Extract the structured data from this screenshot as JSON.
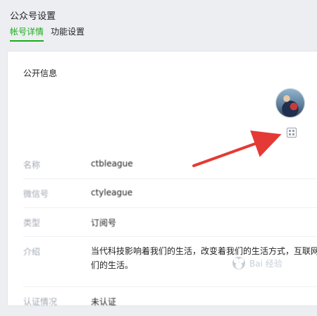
{
  "page": {
    "title": "公众号设置"
  },
  "tabs": [
    {
      "label": "帐号详情",
      "active": true
    },
    {
      "label": "功能设置",
      "active": false
    }
  ],
  "section": {
    "title": "公开信息"
  },
  "fields": [
    {
      "label": "名称",
      "value": "ctbleague"
    },
    {
      "label": "微信号",
      "value": "ctyleague"
    },
    {
      "label": "类型",
      "value": "订阅号"
    },
    {
      "label": "介绍",
      "value": "当代科技影响着我们的生活，改变着我们的生活方式，互联网们的生活。"
    },
    {
      "label": "认证情况",
      "value": "未认证"
    }
  ],
  "icons": {
    "avatar": "avatar",
    "qr": "qr-code-icon",
    "watermark": "baidu-jingyan-watermark"
  },
  "colors": {
    "accent": "#1aad19",
    "arrow": "#e53935"
  },
  "watermark": {
    "text": "Bai 经验"
  }
}
